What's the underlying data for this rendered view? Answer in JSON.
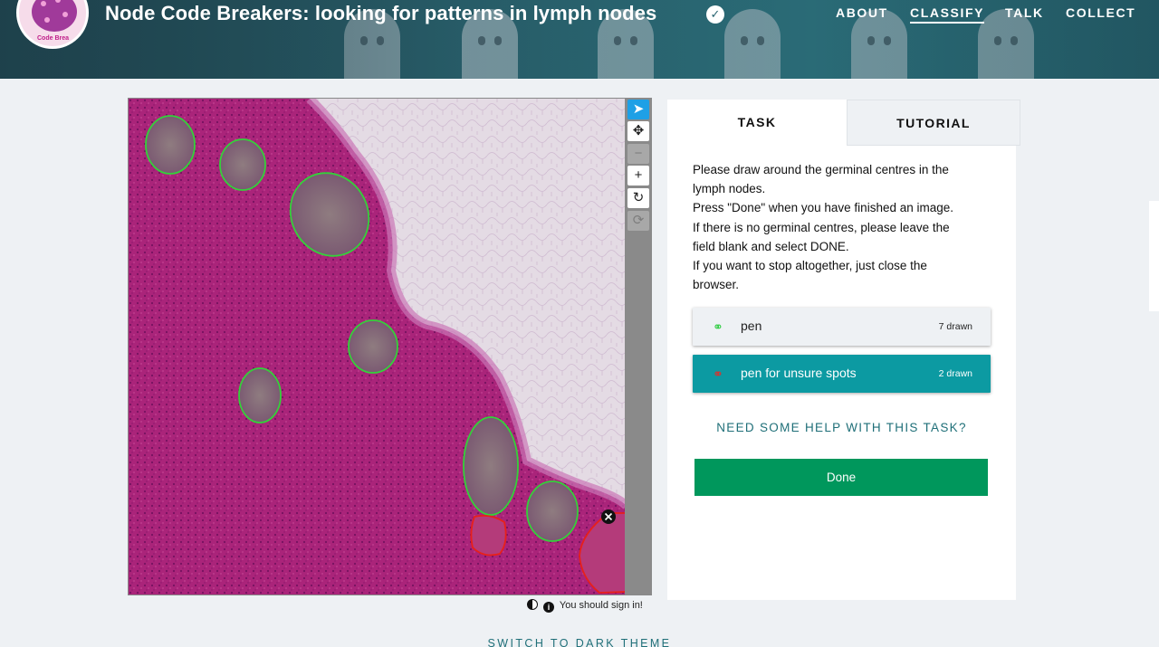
{
  "header": {
    "project_title": "Node Code Breakers: looking for patterns in lymph nodes",
    "avatar_text": "Code Brea",
    "nav": [
      "ABOUT",
      "CLASSIFY",
      "TALK",
      "COLLECT"
    ],
    "active_nav": "CLASSIFY"
  },
  "viewer": {
    "tools": [
      "pointer-icon",
      "move-icon",
      "zoom-out-icon",
      "zoom-in-icon",
      "rotate-icon",
      "reset-icon"
    ],
    "signin_text": "You should sign in!",
    "marks": {
      "pen_green": 7,
      "unsure_red": 2
    }
  },
  "task_panel": {
    "tabs": [
      "TASK",
      "TUTORIAL"
    ],
    "instructions": [
      "Please draw around the germinal centres in the",
      "lymph nodes.",
      "Press \"Done\" when you have finished an image.",
      "If there is no germinal centres, please leave the",
      "field blank and select DONE.",
      "If you want to stop altogether, just close the",
      "browser."
    ],
    "tools": [
      {
        "label": "pen",
        "count": "7 drawn",
        "color": "#2ecc40"
      },
      {
        "label": "pen for unsure spots",
        "count": "2 drawn",
        "color": "#e0302a"
      }
    ],
    "help_link": "NEED SOME HELP WITH THIS TASK?",
    "done_label": "Done"
  },
  "footer": {
    "theme_link": "SWITCH TO DARK THEME"
  },
  "colors": {
    "accent": "#0c9aa2",
    "done": "#00975c",
    "header": "#2a6672"
  }
}
